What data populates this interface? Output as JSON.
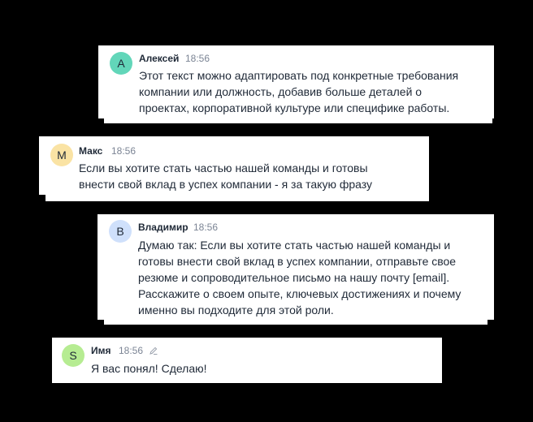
{
  "messages": [
    {
      "author": "Алексей",
      "time": "18:56",
      "avatar_letter": "A",
      "avatar_color": "#62d6b9",
      "lines": [
        "Этот текст можно адаптировать под конкретные требования",
        "компании или должность, добавив больше деталей о",
        "проектах, корпоративной культуре или специфике работы."
      ]
    },
    {
      "author": "Макс",
      "time": "18:56",
      "avatar_letter": "M",
      "avatar_color": "#fae3a4",
      "lines": [
        "Если вы хотите стать частью нашей команды и готовы",
        "внести свой вклад в успех компании - я за такую фразу"
      ]
    },
    {
      "author": "Владимир",
      "time": "18:56",
      "avatar_letter": "B",
      "avatar_color": "#cfe0fb",
      "lines": [
        "Думаю так: Если вы хотите стать частью нашей команды и",
        "готовы внести свой вклад в успех компании, отправьте свое",
        "резюме и сопроводительное письмо на нашу почту [email].",
        "Расскажите о своем опыте, ключевых достижениях и почему",
        "именно вы подходите для этой роли."
      ]
    },
    {
      "author": "Имя",
      "time": "18:56",
      "avatar_letter": "S",
      "avatar_color": "#b6ec92",
      "edited_icon": "pencil-icon",
      "lines": [
        "Я вас понял! Сделаю!"
      ]
    }
  ]
}
